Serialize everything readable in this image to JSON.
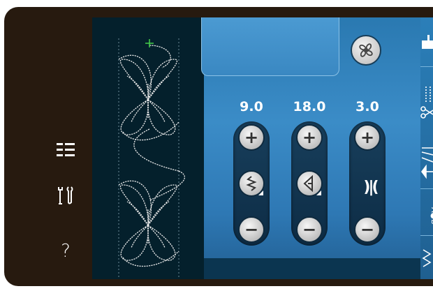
{
  "left_menu": {
    "items": [
      {
        "icon": "menu-list-icon"
      },
      {
        "icon": "tools-icon"
      },
      {
        "icon": "help-icon",
        "glyph": "?"
      }
    ]
  },
  "stitch_preview": {
    "pattern": "decorative-butterfly-stitch",
    "color": "#e8e8e8",
    "marker_color": "#44d04a"
  },
  "controls": {
    "stitch_width": {
      "value": "9.0",
      "icon": "stitch-width-icon"
    },
    "stitch_length": {
      "value": "18.0",
      "icon": "stitch-length-icon"
    },
    "stitch_density": {
      "value": "3.0",
      "icon": "mirror-density-icon",
      "glyph": ")|("
    },
    "plus_glyph": "+",
    "minus_glyph": "−"
  },
  "right_toolbar": {
    "items": [
      "machine-icon",
      "cut-thread-icon",
      "stitch-options-icon",
      "text-abc-icon",
      "zigzag-icon"
    ]
  },
  "colors": {
    "frame": "#271a0f",
    "panel_blue": "#3b8cc7",
    "dark_panel": "#04202c",
    "button_face": "#e6e6e6"
  }
}
